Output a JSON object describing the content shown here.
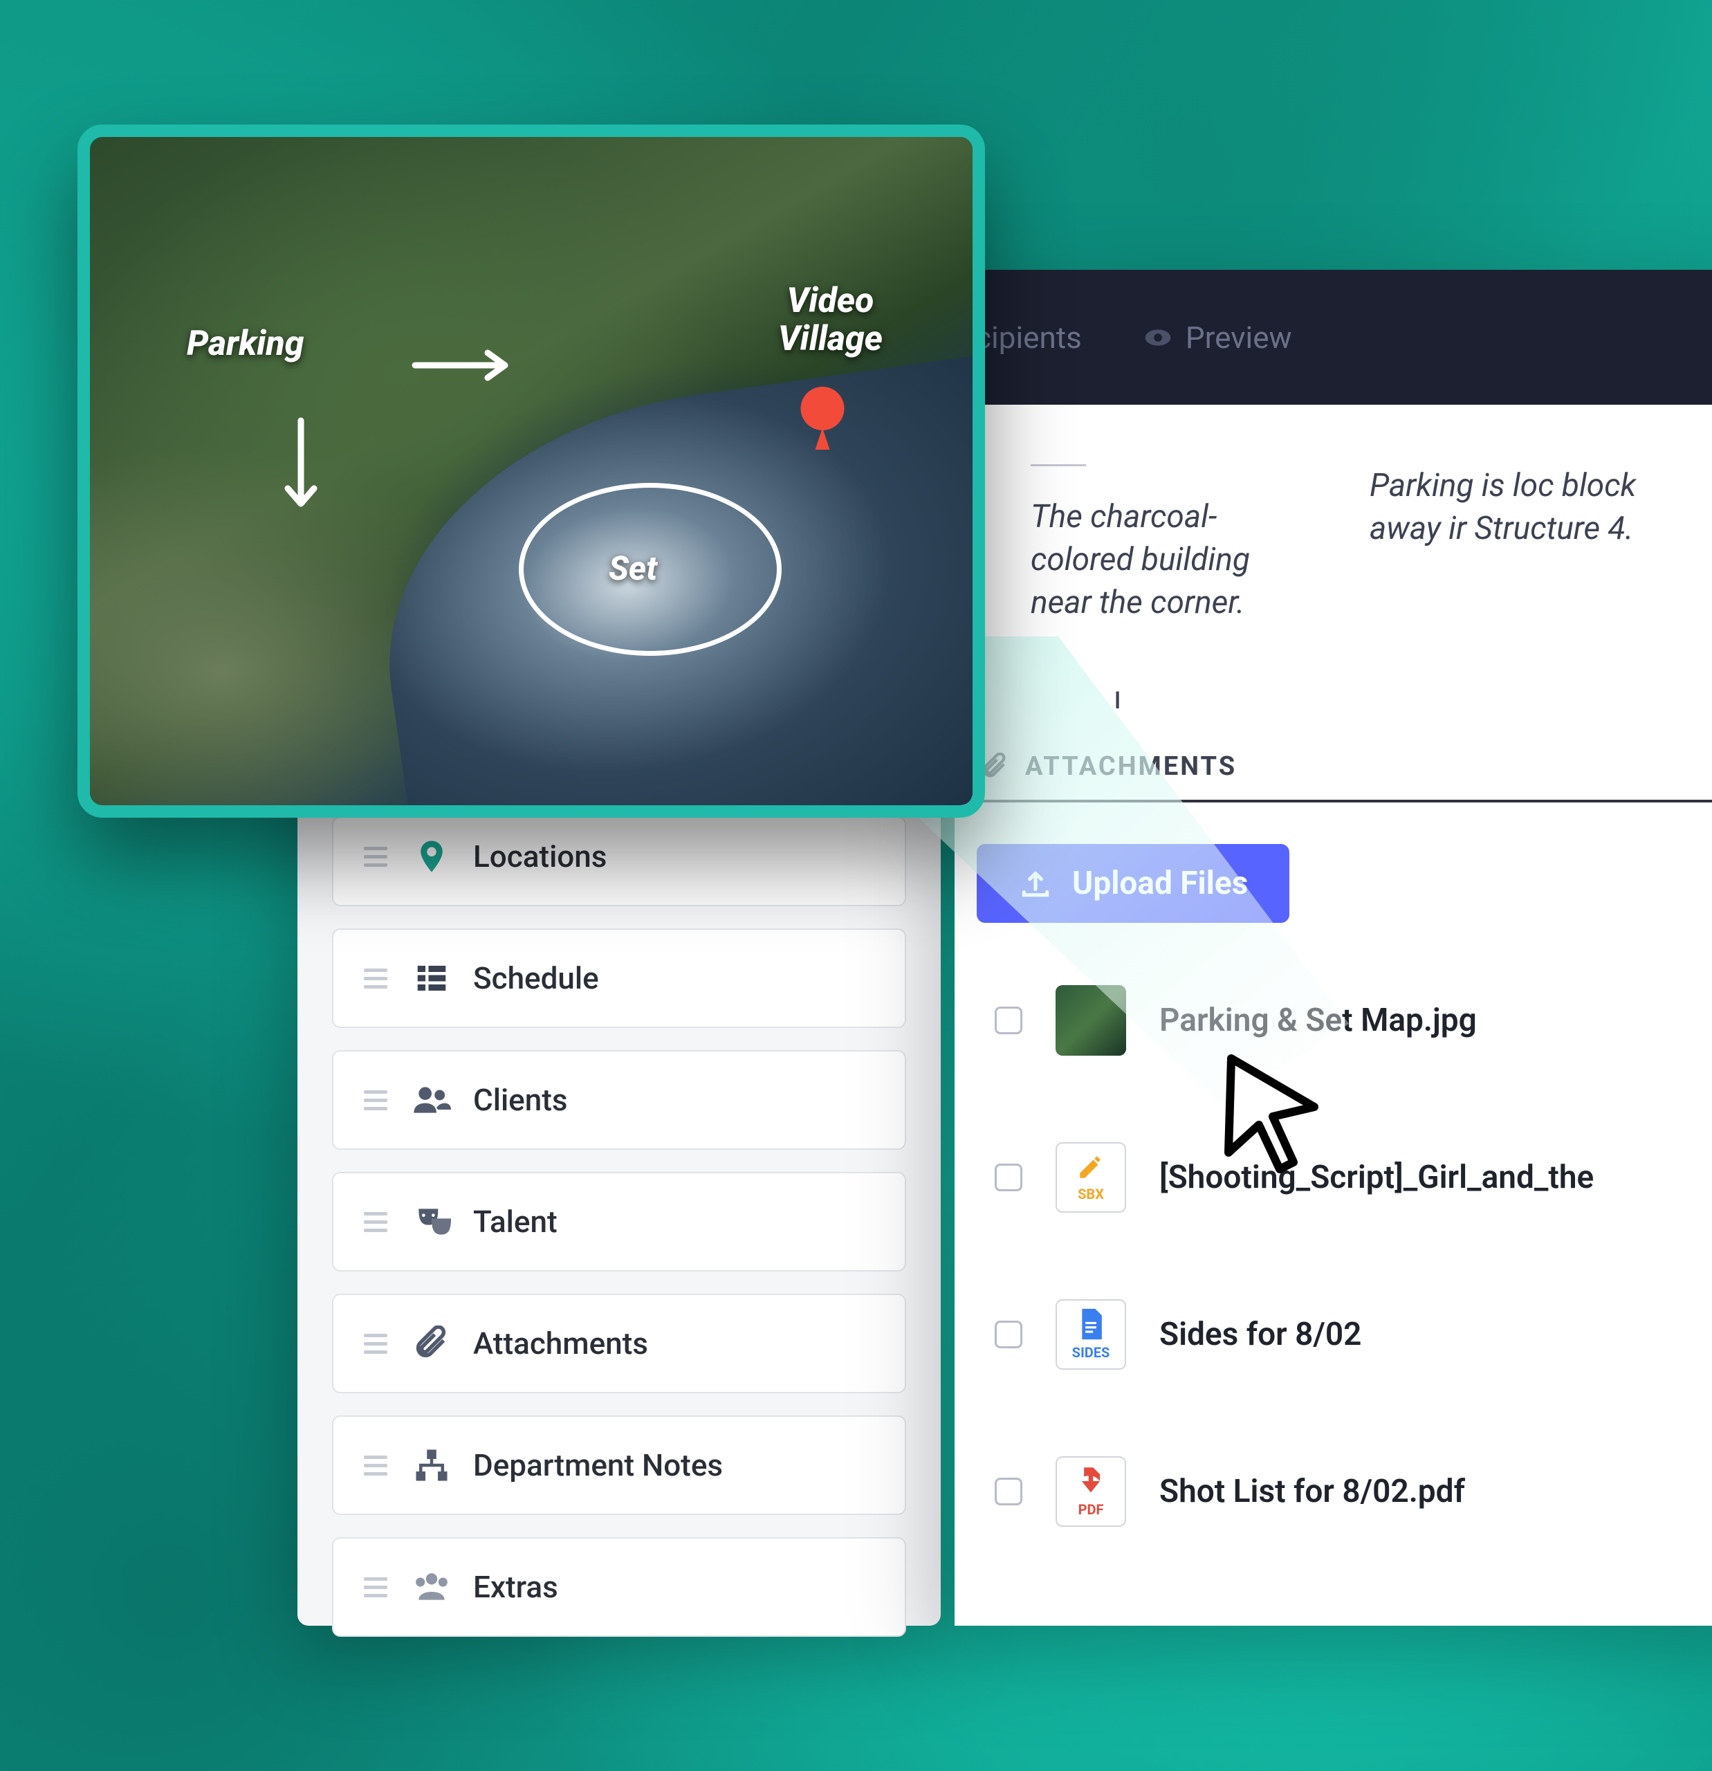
{
  "sidebar": {
    "items": [
      {
        "label": "Locations"
      },
      {
        "label": "Schedule"
      },
      {
        "label": "Clients"
      },
      {
        "label": "Talent"
      },
      {
        "label": "Attachments"
      },
      {
        "label": "Department Notes"
      },
      {
        "label": "Extras"
      }
    ]
  },
  "tabs": {
    "recipients": "cipients",
    "preview": "Preview"
  },
  "notes": {
    "n1": "The charcoal-colored building near the corner.",
    "n2": "Parking is loc block away ir Structure 4."
  },
  "attachments": {
    "header": "ATTACHMENTS",
    "upload_label": "Upload Files",
    "files": [
      {
        "name": "Parking & Set Map.jpg",
        "badge": ""
      },
      {
        "name": "[Shooting_Script]_Girl_and_the",
        "badge": "SBX"
      },
      {
        "name": "Sides for 8/02",
        "badge": "SIDES"
      },
      {
        "name": "Shot List for 8/02.pdf",
        "badge": "PDF"
      }
    ]
  },
  "map": {
    "parking": "Parking",
    "village_l1": "Video",
    "village_l2": "Village",
    "set": "Set"
  },
  "colors": {
    "accent": "#5864ff",
    "teal": "#1fbaa9"
  }
}
